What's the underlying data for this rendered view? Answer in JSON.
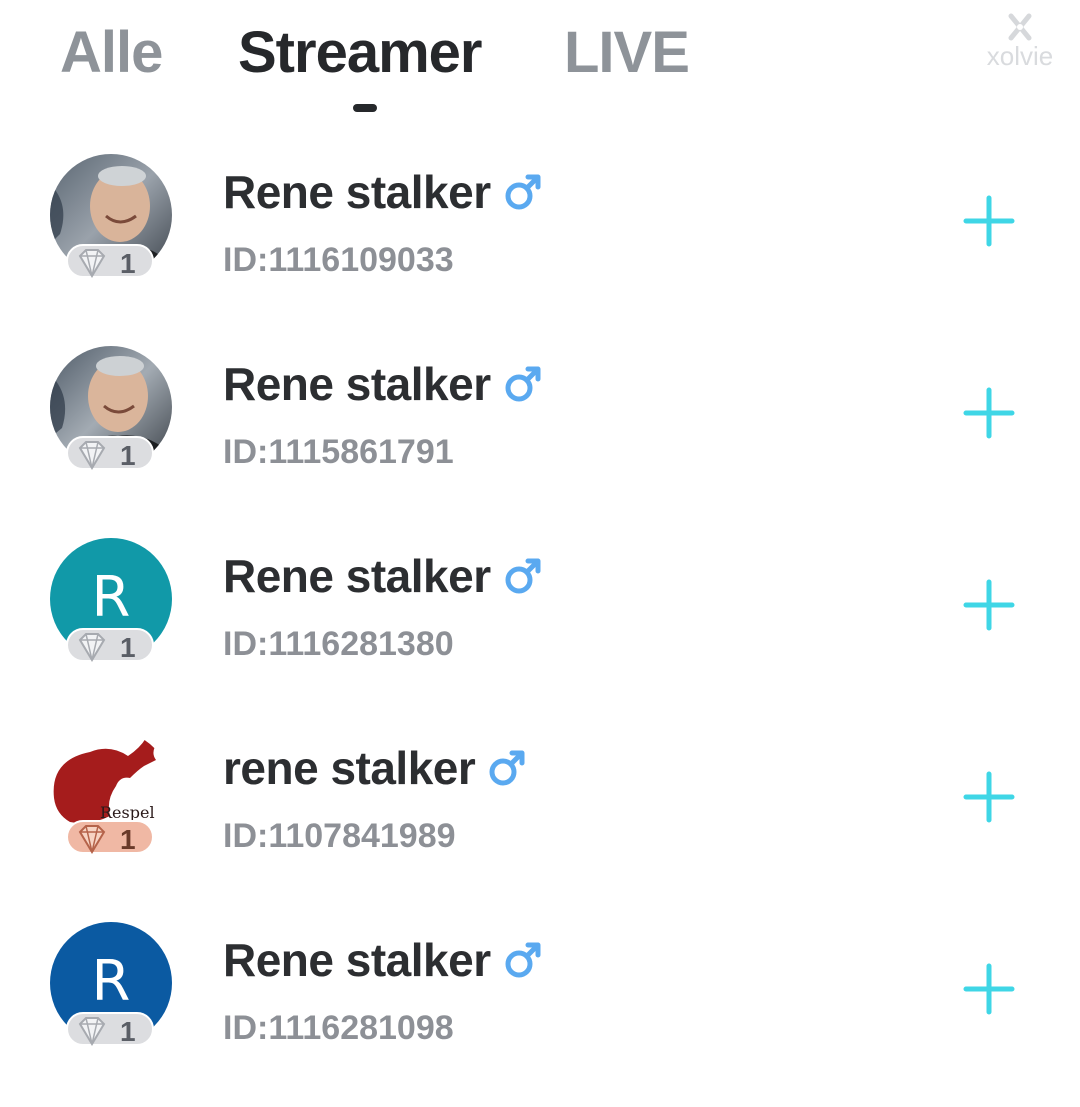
{
  "tabs": [
    {
      "label": "Alle",
      "active": false
    },
    {
      "label": "Streamer",
      "active": true
    },
    {
      "label": "LIVE",
      "active": false
    }
  ],
  "watermark": {
    "text": "xolvie"
  },
  "colors": {
    "active_tab": "#26282b",
    "inactive_tab": "#8e9399",
    "gender_icon": "#5aa9f0",
    "follow_plus": "#3fd6e6",
    "user_id": "#8d9096"
  },
  "users": [
    {
      "name": "Rene stalker",
      "gender_icon": "male-symbol-icon",
      "id_text": "ID:1116109033",
      "avatar": {
        "type": "photo",
        "description": "older man portrait"
      },
      "level": "1",
      "level_tier": "silver",
      "action_icon": "plus-icon"
    },
    {
      "name": "Rene stalker",
      "gender_icon": "male-symbol-icon",
      "id_text": "ID:1115861791",
      "avatar": {
        "type": "photo",
        "description": "older man portrait"
      },
      "level": "1",
      "level_tier": "silver",
      "action_icon": "plus-icon"
    },
    {
      "name": "Rene stalker",
      "gender_icon": "male-symbol-icon",
      "id_text": "ID:1116281380",
      "avatar": {
        "type": "letter",
        "letter": "R",
        "color": "#1199a8"
      },
      "level": "1",
      "level_tier": "silver",
      "action_icon": "plus-icon"
    },
    {
      "name": "rene stalker",
      "gender_icon": "male-symbol-icon",
      "id_text": "ID:1107841989",
      "avatar": {
        "type": "logo",
        "text": "Respel"
      },
      "level": "1",
      "level_tier": "bronze",
      "action_icon": "plus-icon"
    },
    {
      "name": "Rene stalker",
      "gender_icon": "male-symbol-icon",
      "id_text": "ID:1116281098",
      "avatar": {
        "type": "letter",
        "letter": "R",
        "color": "#0b5aa2"
      },
      "level": "1",
      "level_tier": "silver",
      "action_icon": "plus-icon"
    }
  ]
}
